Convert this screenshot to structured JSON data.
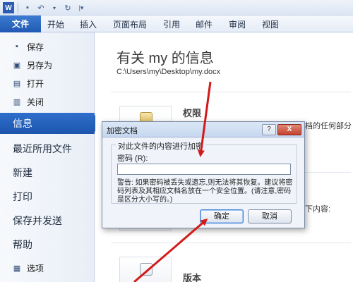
{
  "tabs": [
    "文件",
    "开始",
    "插入",
    "页面布局",
    "引用",
    "邮件",
    "审阅",
    "视图"
  ],
  "sidebar": {
    "small_items": [
      {
        "label": "保存",
        "icon": "save-icon",
        "glyph": "▪"
      },
      {
        "label": "另存为",
        "icon": "save-as-icon",
        "glyph": "▣"
      },
      {
        "label": "打开",
        "icon": "open-folder-icon",
        "glyph": "▤"
      },
      {
        "label": "关闭",
        "icon": "close-folder-icon",
        "glyph": "▥"
      }
    ],
    "big_items": [
      "信息",
      "最近所用文件",
      "新建",
      "打印",
      "保存并发送",
      "帮助"
    ],
    "options": {
      "label": "选项",
      "icon": "options-icon",
      "glyph": "▦"
    }
  },
  "main": {
    "title": "有关 my 的信息",
    "path": "C:\\Users\\my\\Desktop\\my.docx",
    "permissions": {
      "heading": "权限",
      "text_partial": "档的任何部分"
    },
    "inspect": {
      "text_partial": "下内容:"
    },
    "versions": {
      "heading": "版本"
    }
  },
  "dialog": {
    "title": "加密文档",
    "help_label": "?",
    "close_label": "X",
    "group_label": "对此文件的内容进行加密",
    "password_label": "密码 (R):",
    "password_value": "",
    "warning": "警告: 如果密码被丢失或遗忘,则无法将其恢复。建议将密码列表及其相应文档名放在一个安全位置。(请注意,密码是区分大小写的。)",
    "ok_label": "确定",
    "cancel_label": "取消"
  },
  "colors": {
    "file_tab": "#2159b4",
    "active_side": "#1f58b0",
    "arrow": "#d21a1a"
  }
}
